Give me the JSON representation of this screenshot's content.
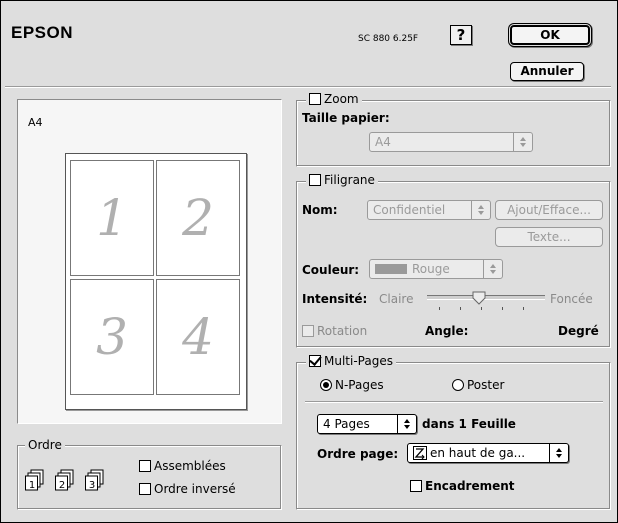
{
  "header": {
    "brand": "EPSON",
    "version": "SC 880 6.25F",
    "help_label": "?",
    "ok_label": "OK",
    "cancel_label": "Annuler"
  },
  "preview": {
    "paper_label": "A4",
    "pages": [
      "1",
      "2",
      "3",
      "4"
    ]
  },
  "zoom": {
    "title": "Zoom",
    "checked": false,
    "paper_size_label": "Taille papier:",
    "paper_size_value": "A4"
  },
  "watermark": {
    "title": "Filigrane",
    "checked": false,
    "name_label": "Nom:",
    "name_value": "Confidentiel",
    "add_delete_label": "Ajout/Efface...",
    "text_label": "Texte...",
    "color_label": "Couleur:",
    "color_value": "Rouge",
    "color_swatch": "#9a9a9a",
    "intensity_label": "Intensité:",
    "intensity_low": "Claire",
    "intensity_high": "Foncée",
    "intensity_fraction": 0.43,
    "rotation_label": "Rotation",
    "rotation_checked": false,
    "angle_label": "Angle:",
    "degree_label": "Degré"
  },
  "multipage": {
    "title": "Multi-Pages",
    "checked": true,
    "npages_label": "N-Pages",
    "npages_selected": true,
    "poster_label": "Poster",
    "poster_selected": false,
    "pages_value": "4 Pages",
    "per_sheet_label": "dans 1 Feuille",
    "page_order_label": "Ordre page:",
    "page_order_value": "en haut de ga...",
    "border_label": "Encadrement",
    "border_checked": false
  },
  "order": {
    "title": "Ordre",
    "collate_label": "Assemblées",
    "collate_checked": false,
    "reverse_label": "Ordre inversé",
    "reverse_checked": false,
    "icon_numbers": [
      "1",
      "2",
      "3"
    ]
  }
}
